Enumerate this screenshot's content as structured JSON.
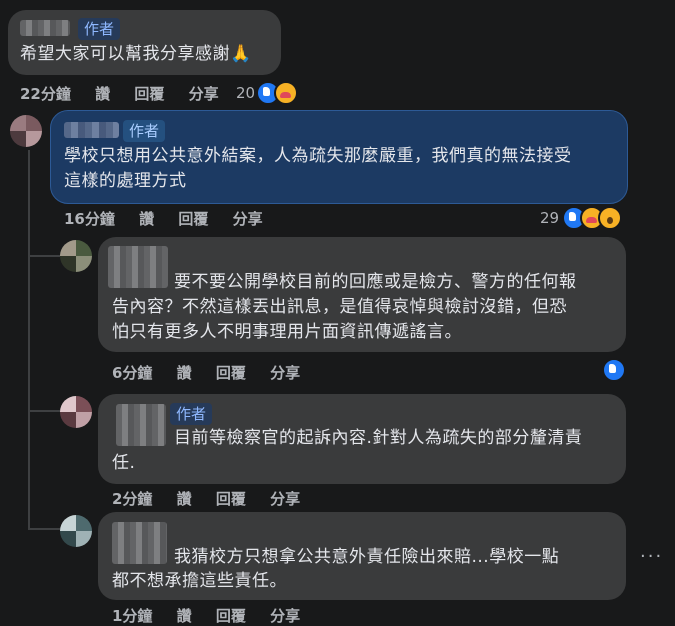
{
  "comments": [
    {
      "badge": "作者",
      "text": "希望大家可以幫我分享感謝🙏",
      "time": "22分鐘",
      "actions": [
        "讚",
        "回覆",
        "分享"
      ],
      "reactions_count": "20"
    },
    {
      "badge": "作者",
      "text_lines": [
        "學校只想用公共意外結案，人為疏失那麼嚴重，我們真的無法接受",
        "這樣的處理方式"
      ],
      "time": "16分鐘",
      "actions": [
        "讚",
        "回覆",
        "分享"
      ],
      "reactions_count": "29"
    },
    {
      "text_lines": [
        "要不要公開學校目前的回應或是檢方、警方的任何報",
        "告內容？不然這樣丟出訊息，是值得哀悼與檢討沒錯，但恐",
        "怕只有更多人不明事理用片面資訊傳遞謠言。"
      ],
      "time": "6分鐘",
      "actions": [
        "讚",
        "回覆",
        "分享"
      ]
    },
    {
      "badge": "作者",
      "text_lines": [
        "目前等檢察官的起訴內容.針對人為疏失的部分釐清責",
        "任."
      ],
      "time": "2分鐘",
      "actions": [
        "讚",
        "回覆",
        "分享"
      ]
    },
    {
      "text_lines": [
        "我猜校方只想拿公共意外責任險出來賠...學校一點",
        "都不想承擔這些責任。"
      ],
      "time": "1分鐘",
      "actions": [
        "讚",
        "回覆",
        "分享"
      ]
    }
  ],
  "more_options": "···",
  "colors": {
    "background": "#18191a",
    "bubble": "#3a3b3c",
    "highlight_bubble": "#1c3a63",
    "author_badge_text": "#8fb8ff",
    "like_blue": "#2078f4"
  }
}
